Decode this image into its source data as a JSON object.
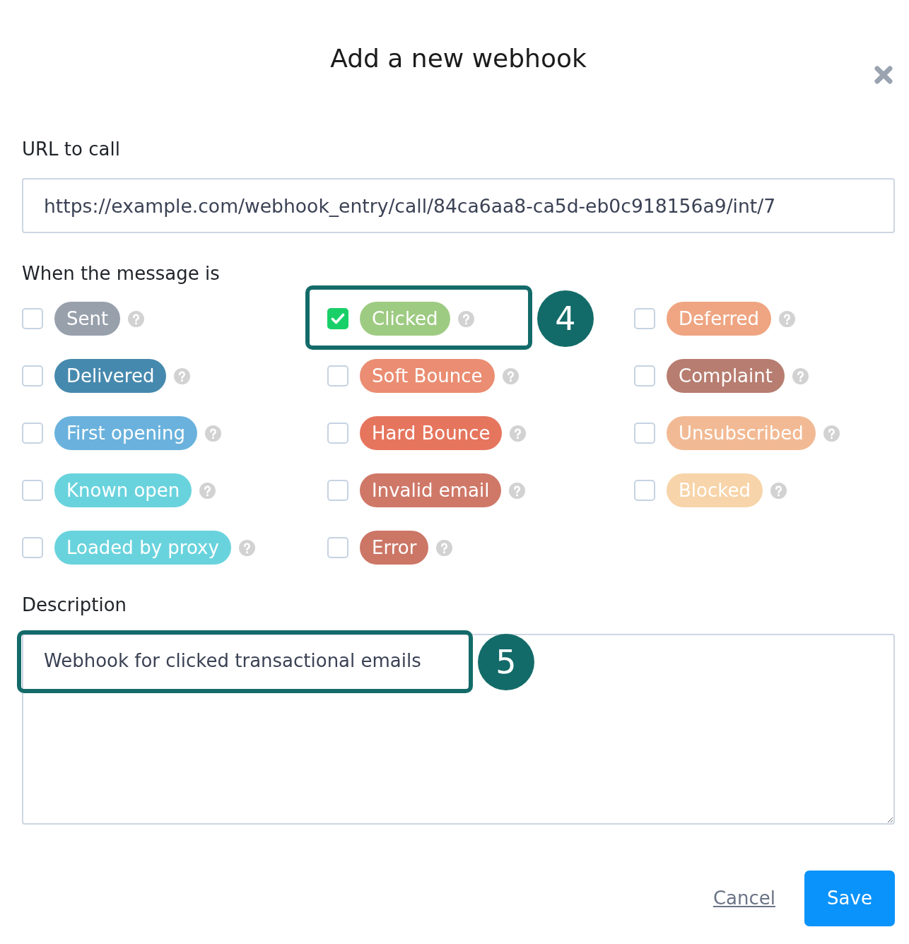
{
  "dialog": {
    "title": "Add a new webhook"
  },
  "url_field": {
    "label": "URL to call",
    "value": "https://example.com/webhook_entry/call/84ca6aa8-ca5d-eb0c918156a9/int/7"
  },
  "events": {
    "label": "When the message is",
    "columns": [
      [
        {
          "label": "Sent",
          "color": "#98a0ac",
          "checked": false
        },
        {
          "label": "Delivered",
          "color": "#4689ae",
          "checked": false
        },
        {
          "label": "First opening",
          "color": "#6ab2dd",
          "checked": false
        },
        {
          "label": "Known open",
          "color": "#69d3dd",
          "checked": false
        },
        {
          "label": "Loaded by proxy",
          "color": "#69d3dd",
          "checked": false
        }
      ],
      [
        {
          "label": "Clicked",
          "color": "#9ecb82",
          "checked": true,
          "callout": "4"
        },
        {
          "label": "Soft Bounce",
          "color": "#ea8d72",
          "checked": false
        },
        {
          "label": "Hard Bounce",
          "color": "#e6755e",
          "checked": false
        },
        {
          "label": "Invalid email",
          "color": "#cf7868",
          "checked": false
        },
        {
          "label": "Error",
          "color": "#cc7666",
          "checked": false
        }
      ],
      [
        {
          "label": "Deferred",
          "color": "#efa582",
          "checked": false
        },
        {
          "label": "Complaint",
          "color": "#b77d70",
          "checked": false
        },
        {
          "label": "Unsubscribed",
          "color": "#f2ba94",
          "checked": false
        },
        {
          "label": "Blocked",
          "color": "#f7d4a9",
          "checked": false
        }
      ]
    ]
  },
  "description": {
    "label": "Description",
    "value": "Webhook for clicked transactional emails",
    "callout": "5"
  },
  "actions": {
    "cancel": "Cancel",
    "save": "Save"
  }
}
